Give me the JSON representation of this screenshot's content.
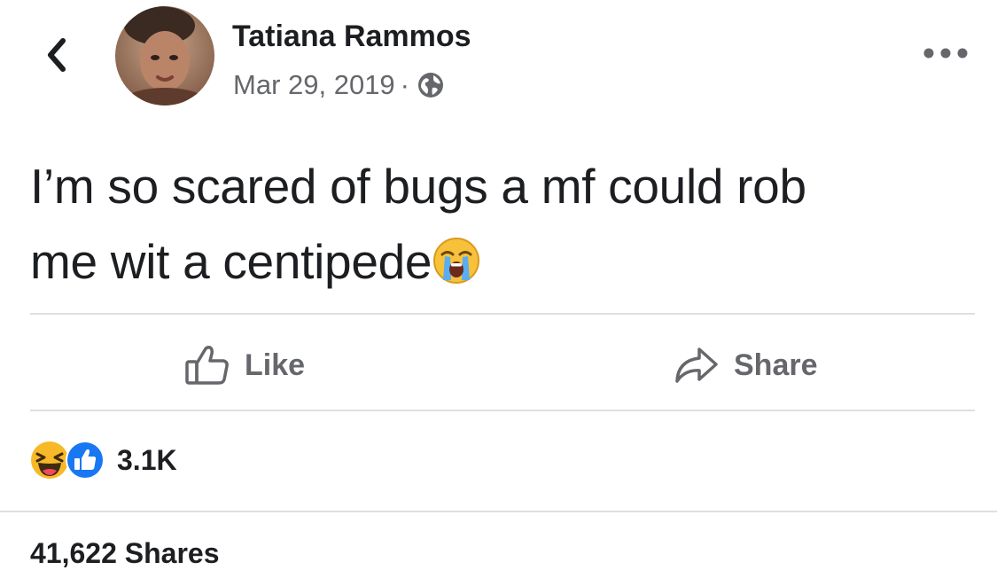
{
  "post": {
    "author": "Tatiana Rammos",
    "date": "Mar 29, 2019",
    "separator": "·",
    "privacy_icon": "globe-icon",
    "text_line1": "I’m so scared of bugs a mf could rob",
    "text_line2": "me wit a centipede",
    "emoji": "loudly-crying-face"
  },
  "actions": {
    "like_label": "Like",
    "share_label": "Share"
  },
  "reactions": {
    "types": [
      "haha",
      "like"
    ],
    "count": "3.1K"
  },
  "shares": {
    "label": "41,622 Shares"
  },
  "colors": {
    "text": "#1c1e21",
    "secondary": "#65676b",
    "like_blue": "#1877f2",
    "haha_yellow": "#f7b928",
    "divider": "#dddfe2"
  }
}
